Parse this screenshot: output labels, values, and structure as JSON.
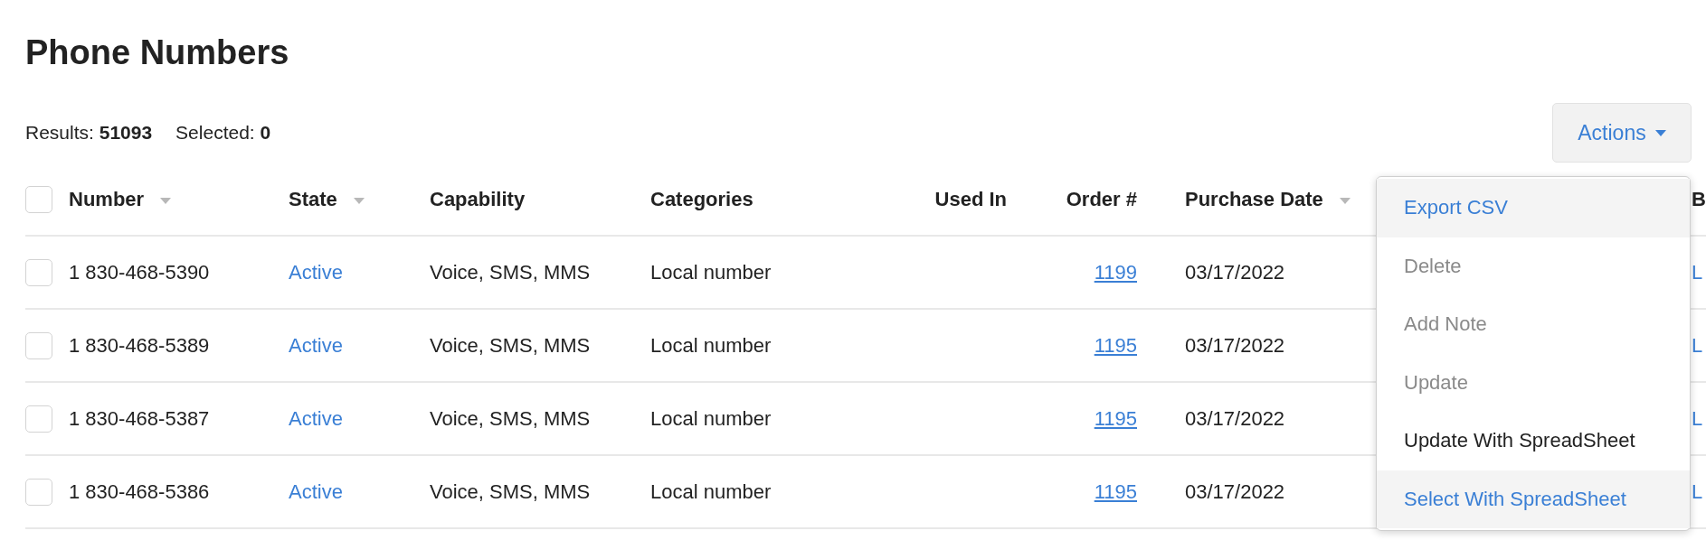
{
  "title": "Phone Numbers",
  "summary": {
    "results": "Results: **51093**",
    "selected": "Selected: **0**"
  },
  "actions_button": {
    "label": "Actions",
    "expanded": true
  },
  "table": {
    "select_all": {
      "checked": false
    },
    "columns": [
      {
        "label": "Number",
        "sortable": true
      },
      {
        "label": "State",
        "sortable": true
      },
      {
        "label": "Capability",
        "sortable": false
      },
      {
        "label": "Categories",
        "sortable": false
      },
      {
        "label": "Used In",
        "sortable": false
      },
      {
        "label": "Order #",
        "sortable": false
      },
      {
        "label": "Purchase Date",
        "sortable": true
      },
      {
        "label": "B",
        "sortable": false
      }
    ],
    "rows": [
      {
        "checked": false,
        "number": "1 830-468-5390",
        "state": "Active",
        "capability": "Voice, SMS, MMS",
        "categories": "Local number",
        "order": "1199",
        "purchase_date": "03/17/2022",
        "column_9": "L"
      },
      {
        "checked": false,
        "number": "1 830-468-5389",
        "state": "Active",
        "capability": "Voice, SMS, MMS",
        "categories": "Local number",
        "order": "1195",
        "purchase_date": "03/17/2022",
        "column_9": "L"
      },
      {
        "checked": false,
        "number": "1 830-468-5387",
        "state": "Active",
        "capability": "Voice, SMS, MMS",
        "categories": "Local number",
        "order": "1195",
        "purchase_date": "03/17/2022",
        "column_9": "L"
      },
      {
        "checked": false,
        "number": "1 830-468-5386",
        "state": "Active",
        "capability": "Voice, SMS, MMS",
        "categories": "Local number",
        "order": "1195",
        "purchase_date": "03/17/2022",
        "column_9": "L"
      }
    ]
  },
  "actions_menu": [
    {
      "label": "Export CSV",
      "disabled": false,
      "highlighted": true
    },
    {
      "label": "Delete",
      "disabled": true,
      "highlighted": false
    },
    {
      "label": "Add Note",
      "disabled": true,
      "highlighted": false
    },
    {
      "label": "Update",
      "disabled": true,
      "highlighted": false
    },
    {
      "label": "Update With SpreadSheet",
      "disabled": false,
      "highlighted": false
    },
    {
      "label": "Select With SpreadSheet",
      "disabled": false,
      "highlighted": true
    }
  ]
}
